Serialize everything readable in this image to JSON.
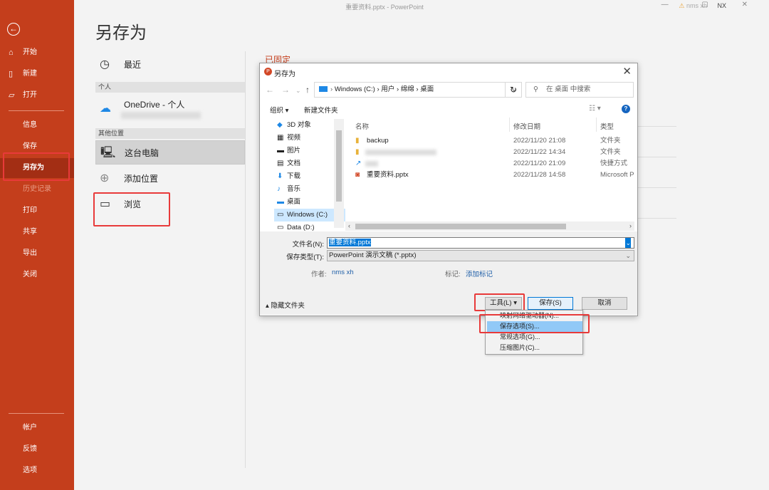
{
  "window": {
    "title": "重要资料.pptx  -  PowerPoint",
    "user_badge": "NX",
    "user_name": "nms xh",
    "controls": "— ▢ ✕"
  },
  "nav": {
    "back_icon": "back-arrow-icon",
    "items": [
      {
        "label": "开始",
        "icon": "home-icon"
      },
      {
        "label": "新建",
        "icon": "new-doc-icon"
      },
      {
        "label": "打开",
        "icon": "folder-open-icon"
      }
    ],
    "sub_items": [
      "信息",
      "保存",
      "另存为",
      "历史记录",
      "打印",
      "共享",
      "导出",
      "关闭"
    ],
    "bottom_items": [
      "帐户",
      "反馈",
      "选项"
    ],
    "active": "另存为"
  },
  "page": {
    "title": "另存为",
    "recent": "最近",
    "personal_header": "个人",
    "onedrive": "OneDrive - 个人",
    "other_header": "其他位置",
    "this_pc": "这台电脑",
    "add_location": "添加位置",
    "browse": "浏览",
    "pinned": "已固定"
  },
  "dialog": {
    "title": "另存为",
    "address": {
      "parts": [
        "Windows (C:)",
        "用户",
        "绵绵",
        "桌面"
      ],
      "separator": "›"
    },
    "search_placeholder": "在 桌面 中搜索",
    "toolbar": {
      "organize": "组织 ▾",
      "new_folder": "新建文件夹"
    },
    "tree": [
      "3D 对象",
      "视频",
      "图片",
      "文档",
      "下载",
      "音乐",
      "桌面",
      "Windows (C:)",
      "Data (D:)"
    ],
    "tree_selected": "Windows (C:)",
    "columns": {
      "name": "名称",
      "modified": "修改日期",
      "type": "类型"
    },
    "files": [
      {
        "name": "backup",
        "modified": "2022/11/20 21:08",
        "type": "文件夹",
        "icon": "folder-icon"
      },
      {
        "name": "",
        "modified": "2022/11/22 14:34",
        "type": "文件夹",
        "icon": "folder-icon"
      },
      {
        "name": "",
        "modified": "2022/11/20 21:09",
        "type": "快捷方式",
        "icon": "shortcut-icon"
      },
      {
        "name": "重要资料.pptx",
        "modified": "2022/11/28 14:58",
        "type": "Microsoft Po",
        "icon": "pptx-icon"
      }
    ],
    "form": {
      "filename_label": "文件名(N):",
      "filename": "重要资料.pptx",
      "filetype_label": "保存类型(T):",
      "filetype": "PowerPoint 演示文稿 (*.pptx)",
      "author_label": "作者:",
      "author": "nms xh",
      "tags_label": "标记:",
      "tags": "添加标记"
    },
    "hide_folders": "隐藏文件夹",
    "buttons": {
      "tools": "工具(L)",
      "save": "保存(S)",
      "cancel": "取消"
    }
  },
  "tools_menu": {
    "items": [
      "映射网络驱动器(N)...",
      "保存选项(S)...",
      "常规选项(G)...",
      "压缩图片(C)..."
    ],
    "highlighted": "保存选项(S)..."
  },
  "colors": {
    "nav_bg": "#c43e1c",
    "highlight_box": "#e83a3a",
    "selection": "#0078d7",
    "menu_highlight": "#91c9f7"
  }
}
